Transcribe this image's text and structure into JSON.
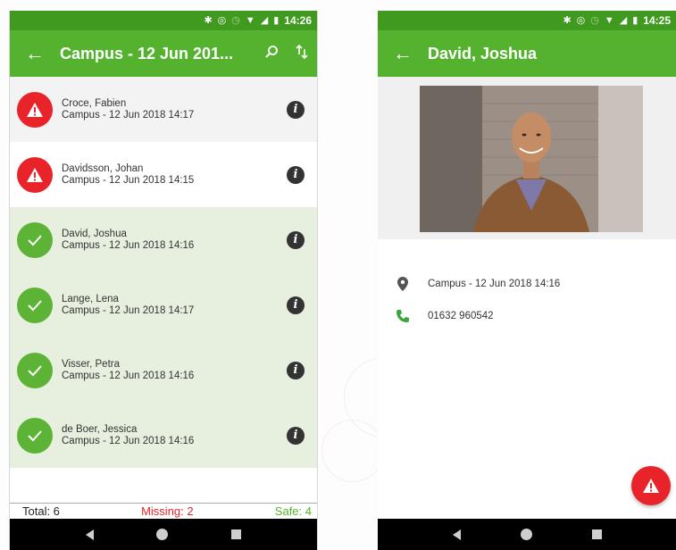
{
  "left": {
    "status": {
      "time": "14:26"
    },
    "appbar": {
      "title": "Campus - 12 Jun 201..."
    },
    "list": [
      {
        "name": "Croce, Fabien",
        "subtitle": "Campus - 12 Jun 2018 14:17",
        "state": "missing"
      },
      {
        "name": "Davidsson, Johan",
        "subtitle": "Campus - 12 Jun 2018 14:15",
        "state": "missing"
      },
      {
        "name": "David, Joshua",
        "subtitle": "Campus - 12 Jun 2018 14:16",
        "state": "safe"
      },
      {
        "name": "Lange, Lena",
        "subtitle": "Campus - 12 Jun 2018 14:17",
        "state": "safe"
      },
      {
        "name": "Visser, Petra",
        "subtitle": "Campus - 12 Jun 2018 14:16",
        "state": "safe"
      },
      {
        "name": "de Boer, Jessica",
        "subtitle": "Campus - 12 Jun 2018 14:16",
        "state": "safe"
      }
    ],
    "footer": {
      "total": "Total: 6",
      "missing": "Missing: 2",
      "safe": "Safe: 4"
    }
  },
  "right": {
    "status": {
      "time": "14:25"
    },
    "appbar": {
      "title": "David, Joshua"
    },
    "location": "Campus - 12 Jun 2018 14:16",
    "phone": "01632 960542"
  },
  "colors": {
    "brand_green": "#55b22e",
    "status_green": "#3f9a1f",
    "missing_red": "#e8242a",
    "safe_row_bg": "#e7efdf"
  },
  "icons": {
    "back": "arrow-left-icon",
    "search": "search-icon",
    "sort": "sort-icon",
    "warning": "warning-icon",
    "check": "check-icon",
    "info": "info-icon",
    "location": "location-pin-icon",
    "phone": "phone-icon"
  }
}
